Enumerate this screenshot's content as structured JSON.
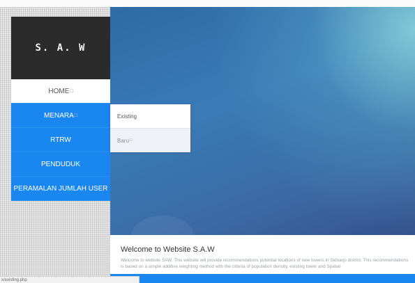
{
  "brand": {
    "title": "S. A. W"
  },
  "nav": {
    "items": [
      {
        "label": "HOME",
        "glyph": "□"
      },
      {
        "label": "MENARA",
        "glyph": "□"
      },
      {
        "label": "RTRW",
        "glyph": ""
      },
      {
        "label": "PENDUDUK",
        "glyph": ""
      },
      {
        "label": "PERAMALAN JUMLAH USER",
        "glyph": ""
      }
    ]
  },
  "submenu": {
    "items": [
      {
        "label": "Existing",
        "glyph": ""
      },
      {
        "label": "Baru",
        "glyph": "□"
      }
    ]
  },
  "welcome": {
    "title": "Welcome to Website S.A.W",
    "text": "Welcome to website SAW. This website will provide recommendations potential locations of new towers in Sidoarjo district. This recommendations is based on a simple additive weighting method with the criteria of population density, existing tower and Spatial"
  },
  "status_bar": {
    "url": "x/existing.php"
  },
  "colors": {
    "accent": "#1a86f0",
    "brand_bg": "#2b2b2b"
  }
}
